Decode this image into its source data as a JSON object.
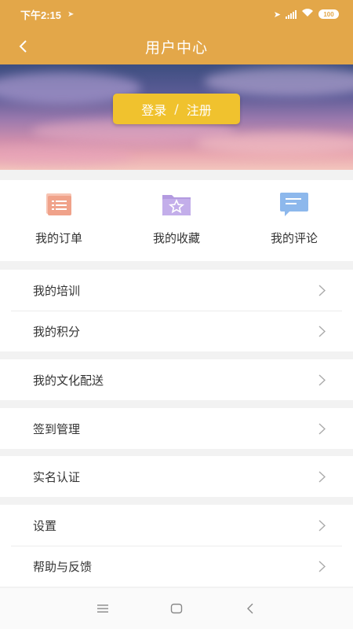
{
  "status_bar": {
    "time": "下午2:15",
    "battery": "100"
  },
  "header": {
    "title": "用户中心",
    "back_icon": "chevron-left-icon"
  },
  "banner": {
    "login_label": "登录",
    "separator": "/",
    "register_label": "注册",
    "button_color": "#f0c22e"
  },
  "quick_actions": [
    {
      "label": "我的订单",
      "icon": "order-list-icon",
      "color": "#f0a28a"
    },
    {
      "label": "我的收藏",
      "icon": "favorite-folder-icon",
      "color": "#b39ae0"
    },
    {
      "label": "我的评论",
      "icon": "comment-bubble-icon",
      "color": "#8db8ec"
    }
  ],
  "menu_groups": [
    [
      {
        "label": "我的培训"
      },
      {
        "label": "我的积分"
      }
    ],
    [
      {
        "label": "我的文化配送"
      }
    ],
    [
      {
        "label": "签到管理"
      }
    ],
    [
      {
        "label": "实名认证"
      }
    ],
    [
      {
        "label": "设置"
      },
      {
        "label": "帮助与反馈"
      }
    ]
  ],
  "colors": {
    "header_bg": "#e3a749",
    "page_bg": "#f2f2f2"
  },
  "bottom_nav": [
    "menu-icon",
    "home-square-icon",
    "back-triangle-icon"
  ]
}
